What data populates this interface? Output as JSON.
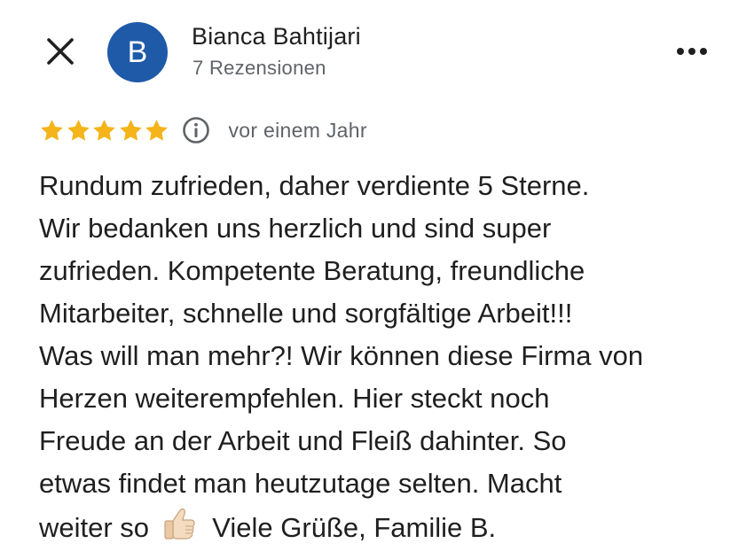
{
  "header": {
    "author_name": "Bianca Bahtijari",
    "review_count": "7 Rezensionen",
    "avatar_initial": "B",
    "avatar_color": "#1e5aa8"
  },
  "icons": {
    "close": "close-icon",
    "more": "more-options-icon",
    "info": "info-icon",
    "star": "star-icon",
    "thumbs_up": "thumbs-up-emoji"
  },
  "rating": {
    "stars": 5,
    "max_stars": 5,
    "star_color": "#f4b41a",
    "date": "vor einem Jahr"
  },
  "review": {
    "lines": [
      "Rundum zufrieden, daher verdiente 5 Sterne.",
      "Wir bedanken uns herzlich und sind super",
      "zufrieden. Kompetente Beratung, freundliche",
      "Mitarbeiter, schnelle und sorgfältige Arbeit!!!",
      "Was will man mehr?! Wir können diese Firma von",
      "Herzen weiterempfehlen. Hier steckt noch",
      "Freude an der Arbeit und Fleiß dahinter. So",
      "etwas findet man heutzutage selten. Macht"
    ],
    "last_line_before_emoji": "weiter so",
    "last_line_after_emoji": "Viele Grüße, Familie B."
  }
}
